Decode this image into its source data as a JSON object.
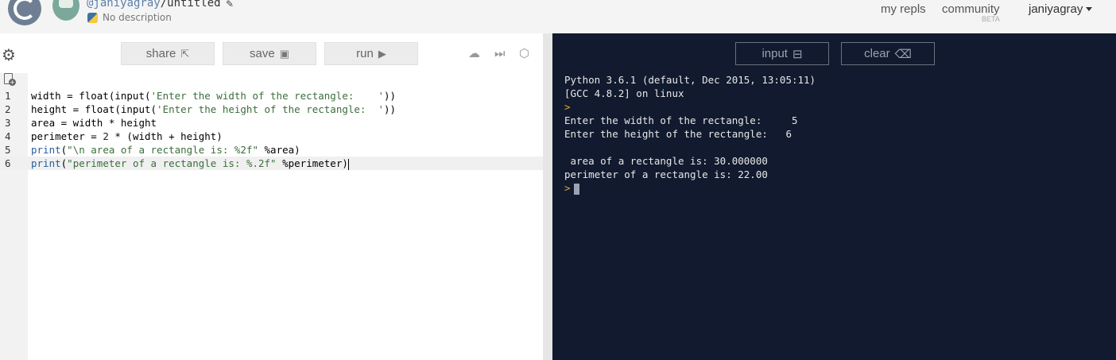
{
  "header": {
    "username": "@janiyagray",
    "separator": "/",
    "repl_name": "untitled",
    "description": "No description",
    "nav": {
      "my_repls": "my repls",
      "community": "community",
      "beta": "BETA",
      "user": "janiyagray"
    }
  },
  "toolbar": {
    "share_label": "share",
    "save_label": "save",
    "run_label": "run"
  },
  "editor": {
    "line_numbers": [
      "1",
      "2",
      "3",
      "4",
      "5",
      "6"
    ],
    "active_line": 6
  },
  "console": {
    "input_label": "input",
    "clear_label": "clear",
    "lines": [
      "Python 3.6.1 (default, Dec 2015, 13:05:11)",
      "[GCC 4.8.2] on linux",
      "",
      "Enter the width of the rectangle:     5",
      "Enter the height of the rectangle:   6",
      "",
      " area of a rectangle is: 30.000000",
      "perimeter of a rectangle is: 22.00"
    ],
    "prompt_symbol": ">"
  },
  "icons": {
    "gear": "gear-icon",
    "new_file": "new-file-icon",
    "share": "share-icon",
    "save": "save-disk-icon",
    "run": "play-icon",
    "cloud": "cloud-upload-icon",
    "skip": "skip-forward-icon",
    "cube": "package-cube-icon",
    "input": "input-icon",
    "clear": "backspace-icon"
  },
  "colors": {
    "console_bg": "#111a2e",
    "prompt": "#e6a531",
    "string": "#3b6e3b",
    "keyword": "#2a5c9e"
  }
}
